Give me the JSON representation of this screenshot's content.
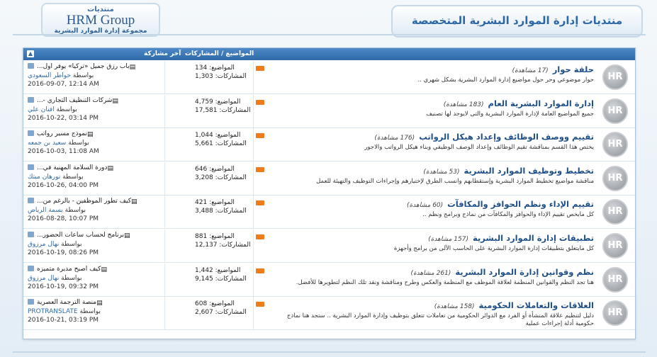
{
  "logo": {
    "top": "منتديات",
    "main": "HRM Group",
    "sub": "مجموعة إدارة الموارد البشرية"
  },
  "page_title": "منتديات إدارة الموارد البشرية المتخصصة",
  "table_header": {
    "last_post": "آخر مشاركة",
    "stats": "المواضيع / المشاركات"
  },
  "labels": {
    "threads": "المواضيع:",
    "posts": "المشاركات:",
    "by": "بواسطة"
  },
  "forums": [
    {
      "title": "حلقة حوار",
      "views": "(17 مشاهدة)",
      "description": "حوار موضوعي وحر حول مواضيع إدارة الموارد البشرية بشكل شهري ..",
      "threads": "134",
      "posts": "1,303",
      "last_title": "باب رزق جميل «تركيا» يوفر أول...",
      "last_user": "خواطر السعودي",
      "last_date": "2016-09-07, 12:14 AM"
    },
    {
      "title": "إدارة الموارد البشرية العام",
      "views": "(183 مشاهدة)",
      "description": "جميع المواضيع العامة لإدارة الموارد البشرية والتى لايوجد لها تصنيف",
      "threads": "4,759",
      "posts": "17,581",
      "last_title": "شركات التنظيف التجاري -...",
      "last_user": "افنان علي",
      "last_date": "2016-10-22, 03:14 PM"
    },
    {
      "title": "تقييم ووصف الوظائف وإعداد هيكل الرواتب",
      "views": "(176 مشاهدة)",
      "description": "يختص هذا القسم بمناقشة تقيم الوظائف وإعداد الوصف الوظيفي وبناء هيكل الرواتب والاجور",
      "threads": "1,044",
      "posts": "5,661",
      "last_title": "نموذج مسير رواتب",
      "last_user": "سعيد بن جمعه",
      "last_date": "2016-10-03, 11:08 AM"
    },
    {
      "title": "تخطيط وتوظيف الموارد البشرية",
      "views": "(53 مشاهدة)",
      "description": "مناقشة مواضيع تخطيط الموارد البشرية وإستقطابهم وانسب الطرق لإختيارهم وإجراءات التوظيف والتهيئة للعمل",
      "threads": "646",
      "posts": "3,208",
      "last_title": "دورة السلامة المهنية في...",
      "last_user": "نورهان مبتك",
      "last_date": "2016-10-26, 04:00 PM"
    },
    {
      "title": "تقييم الإداء ونظم الحوافز والمكافآت",
      "views": "(60 مشاهدة)",
      "description": "كل مايخص تقييم الإداء والحوافز والمكافآت من نماذج وبرامج ونظم ..",
      "threads": "421",
      "posts": "3,488",
      "last_title": "كيف تطور الموظفين - بالرغم من...",
      "last_user": "بسمة الرياض",
      "last_date": "2016-08-28, 10:07 PM"
    },
    {
      "title": "تطبيقات إدارة الموارد البشرية",
      "views": "(157 مشاهدة)",
      "description": "كل مايتعلق بتطبيقات إدارة الموارد البشرية على الحاسب الآلى من برامج وأجهزة",
      "threads": "881",
      "posts": "12,137",
      "last_title": "برنامج لحساب ساعات الحضور...",
      "last_user": "نهال مرزوق",
      "last_date": "2016-10-19, 08:26 PM"
    },
    {
      "title": "نظم وقوانين إدارة الموارد البشرية",
      "views": "(261 مشاهدة)",
      "description": "هنا تجد النظم والقوانين المنظمة لعلاقة الموظف مع المنظمة والعكس وطرح ومناقشة ونقد تلك النظم لتطويرها للأفضل.",
      "threads": "1,442",
      "posts": "9,145",
      "last_title": "كيف اصبح مديرة متميزه",
      "last_user": "نهال مرزوق",
      "last_date": "2016-10-19, 09:32 PM"
    },
    {
      "title": "العلاقات والتعاملات الحكومية",
      "views": "(158 مشاهدة)",
      "description": "دليل لتنظيم علاقة المنشأة أو الفرد مع الدوائر الحكومية من تعاملات تتعلق بتوظيف وإدارة الموارد البشرية .. ستجد هنا نماذج حكومية أدلة إجراءات عملية",
      "threads": "608",
      "posts": "2,607",
      "last_title": "منصة الترجمة العصرية",
      "last_user": "PROTRANSLATE",
      "last_date": "2016-10-21, 03:19 PM"
    }
  ],
  "icon_text": "HR",
  "colors": {
    "header_bar": "#2f6aa8",
    "title_text": "#2c67a6",
    "forum_title": "#1e4f86",
    "feed_icon": "#f07b1a"
  }
}
